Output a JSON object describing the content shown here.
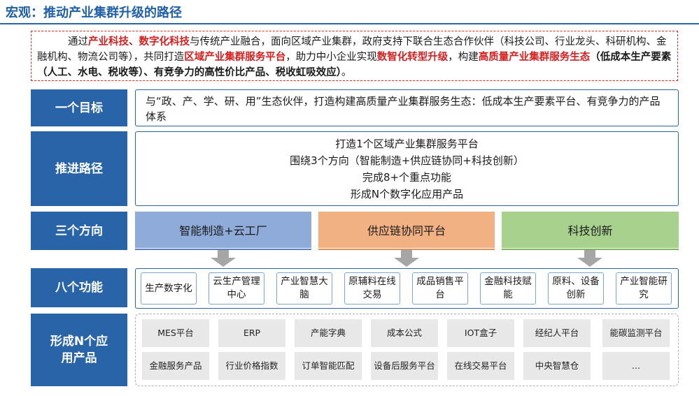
{
  "title": "宏观：推动产业集群升级的路径",
  "intro": {
    "p1": "通过",
    "r1": "产业科技、数字化科技",
    "p2": "与传统产业融合，面向区域产业集群，政府支持下联合生态合作伙伴（科技公司、行业龙头、科研机构、金融机构、物流公司等），共同打造",
    "r2": "区域产业集群服务平台",
    "p3": "，助力中小企业实现",
    "r3": "数智化转型升级",
    "p4": "，构建",
    "r4": "高质量产业集群服务生态",
    "b1": "（低成本生产要素（人工、水电、税收等）、有竞争力的高性价比产品、税收虹吸效应）",
    "p5": "。"
  },
  "rows": {
    "goal": {
      "label": "一个目标",
      "text": "与“政、产、学、研、用”生态伙伴，打造构建高质量产业集群服务生态：低成本生产要素平台、有竞争力的产品体系"
    },
    "path": {
      "label": "推进路径",
      "lines": [
        "打造1个区域产业集群服务平台",
        "围绕3个方向（智能制造+供应链协同+科技创新）",
        "完成8+个重点功能",
        "形成N个数字化应用产品"
      ]
    },
    "directions": {
      "label": "三个方向",
      "items": [
        {
          "label": "智能制造+云工厂",
          "color": "#8fabd9"
        },
        {
          "label": "供应链协同平台",
          "color": "#f2b183"
        },
        {
          "label": "科技创新",
          "color": "#a9d18e"
        }
      ]
    },
    "functions": {
      "label": "八个功能",
      "items": [
        "生产数字化",
        "云生产管理中心",
        "产业智慧大脑",
        "原辅料在线交易",
        "成品销售平台",
        "金融科技赋能",
        "原料、设备创新",
        "产业智能研究"
      ]
    },
    "apps": {
      "label": "形成N个应用产品",
      "items": [
        "MES平台",
        "ERP",
        "产能字典",
        "成本公式",
        "IOT盒子",
        "经纪人平台",
        "能碳监测平台",
        "金融服务产品",
        "行业价格指数",
        "订单智能匹配",
        "设备后服务平台",
        "在线交易平台",
        "中央智慧仓",
        "..."
      ]
    }
  },
  "colors": {
    "label_bg": "#2a64a8",
    "title": "#1f5fa8",
    "highlight": "#d42020",
    "arrow": "#a6a6a6",
    "app_box": "#e8e8e8"
  }
}
